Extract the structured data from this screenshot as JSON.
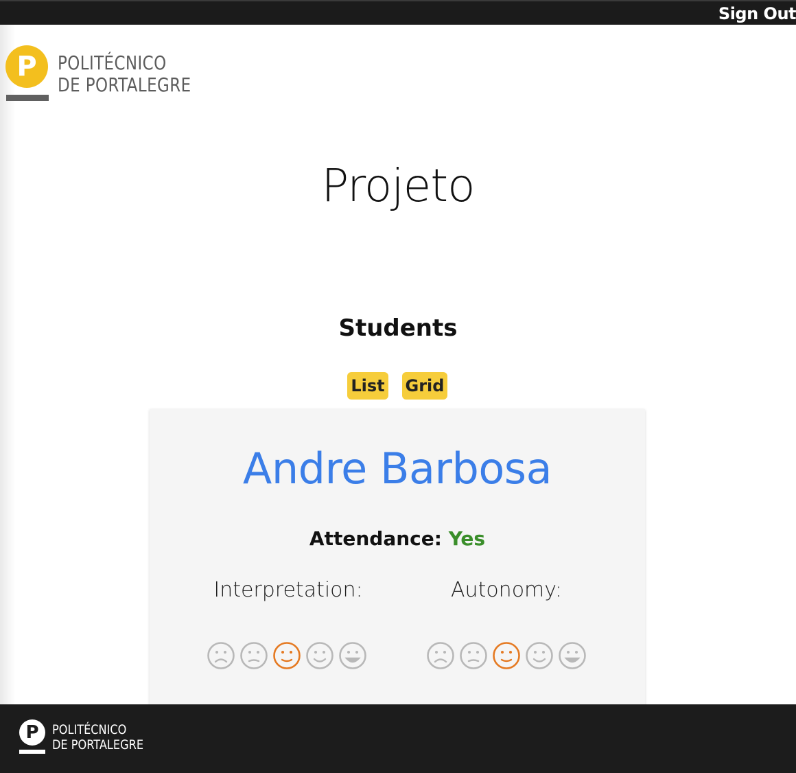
{
  "header": {
    "signout_label": "Sign Out"
  },
  "logo": {
    "line1": "POLITÉCNICO",
    "line2": "DE PORTALEGRE",
    "mark": "P"
  },
  "page": {
    "title": "Projeto"
  },
  "students_section": {
    "title": "Students",
    "view_buttons": {
      "list": "List",
      "grid": "Grid"
    }
  },
  "student_card": {
    "name": "Andre Barbosa",
    "attendance_label": "Attendance:",
    "attendance_value": "Yes",
    "criteria": [
      {
        "label": "Interpretation:",
        "selected_rating": 3,
        "scale_max": 5
      },
      {
        "label": "Autonomy:",
        "selected_rating": 3,
        "scale_max": 5
      }
    ]
  },
  "rating_faces": [
    "very-sad-face-icon",
    "sad-face-icon",
    "neutral-face-icon",
    "happy-face-icon",
    "very-happy-face-icon"
  ],
  "colors": {
    "accent_yellow": "#f6cd3b",
    "name_blue": "#3b7ee8",
    "attendance_green": "#3a8e2a",
    "rating_selected": "#e57a22",
    "rating_unselected": "#b8b8b8"
  },
  "footer": {
    "line1": "POLITÉCNICO",
    "line2": "DE PORTALEGRE",
    "mark": "P"
  }
}
